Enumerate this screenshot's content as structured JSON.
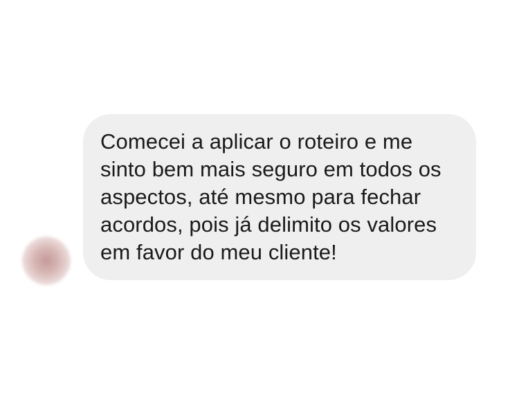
{
  "conversation": {
    "messages": [
      {
        "sender": "other",
        "text": "Comecei a aplicar o roteiro e me sinto bem mais seguro em todos os aspectos, até mesmo para fechar acordos, pois já delimito os valores em favor do meu cliente!"
      }
    ]
  },
  "colors": {
    "bubble_background": "#efefef",
    "text": "#1a1a1a",
    "page_background": "#ffffff"
  }
}
